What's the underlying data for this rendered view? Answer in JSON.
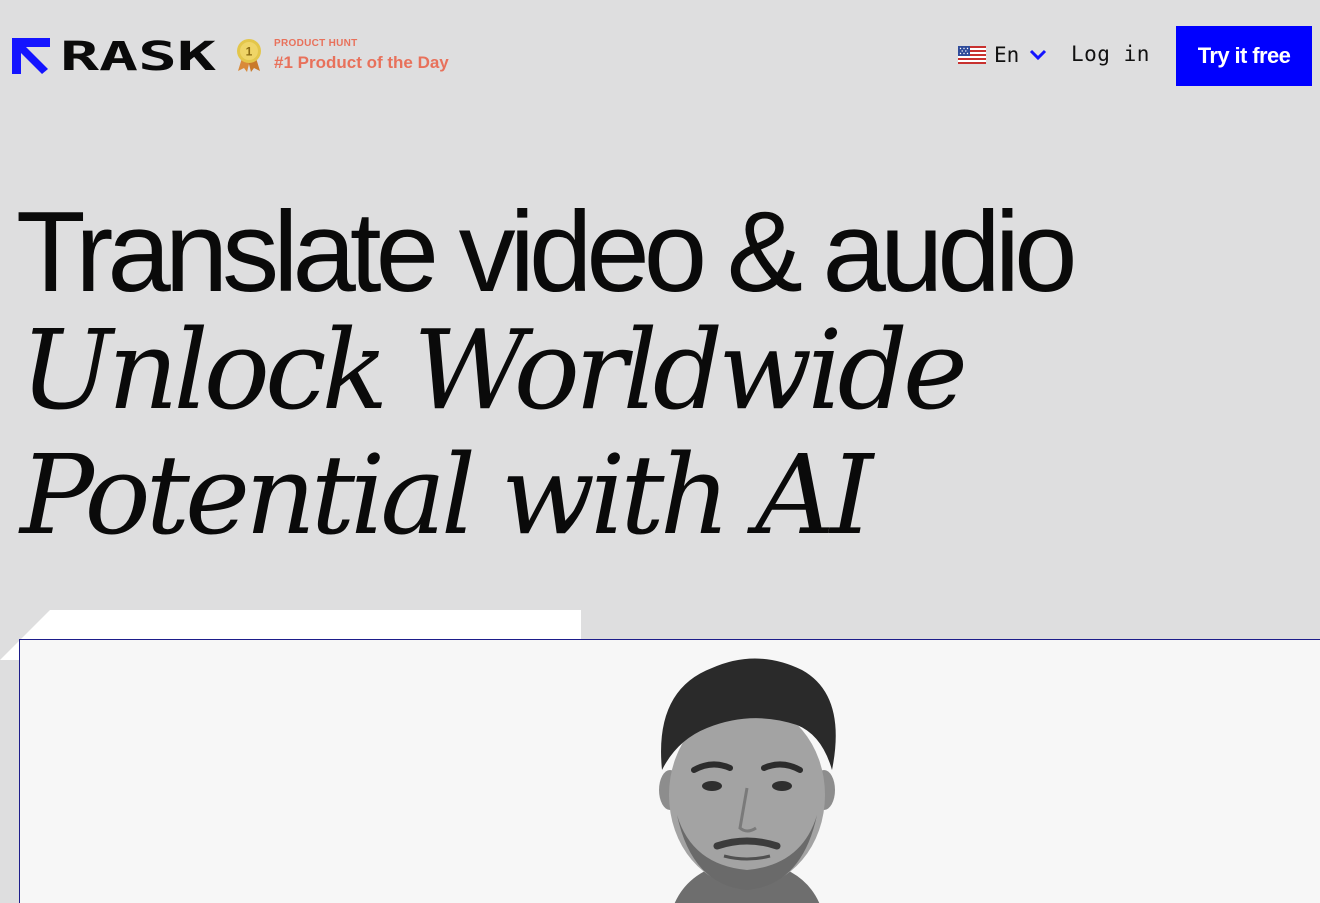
{
  "header": {
    "logo_text": "RASK",
    "product_hunt": {
      "kicker": "PRODUCT HUNT",
      "title": "#1 Product of the Day",
      "medal_rank": "1"
    },
    "language": {
      "flag_icon": "us-flag-icon",
      "code": "En"
    },
    "login_label": "Log in",
    "cta_label": "Try it free"
  },
  "hero": {
    "line1": "Translate video & audio",
    "line2": "Unlock Worldwide",
    "line3": "Potential with AI"
  },
  "media": {
    "image": "presenter-portrait"
  },
  "colors": {
    "background": "#dededf",
    "accent": "#0000ff",
    "product_hunt": "#e8715b",
    "text": "#0a0a0a"
  }
}
